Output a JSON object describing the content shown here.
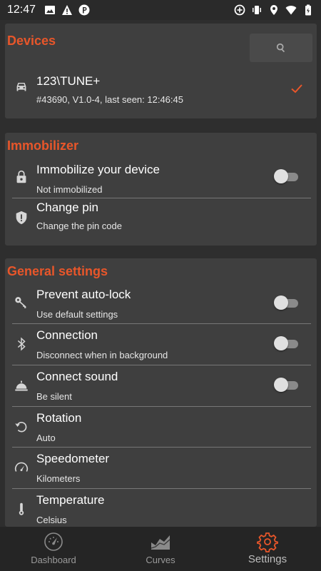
{
  "status_bar": {
    "time": "12:47",
    "left_icons": [
      "image-icon",
      "warning-icon",
      "parking-icon"
    ],
    "right_icons": [
      "data-saver-icon",
      "vibrate-icon",
      "location-icon",
      "wifi-icon",
      "battery-icon"
    ]
  },
  "devices": {
    "title": "Devices",
    "search_icon": "search-icon",
    "device": {
      "name": "123\\TUNE+",
      "detail": "#43690, V1.0-4, last seen: 12:46:45",
      "selected": true
    }
  },
  "immobilizer": {
    "title": "Immobilizer",
    "items": [
      {
        "title": "Immobilize your device",
        "sub": "Not immobilized",
        "toggle": false,
        "icon": "lock-icon"
      },
      {
        "title": "Change pin",
        "sub": "Change the pin code",
        "icon": "shield-icon"
      }
    ]
  },
  "general": {
    "title": "General settings",
    "items": [
      {
        "title": "Prevent auto-lock",
        "sub": "Use default settings",
        "toggle": false,
        "icon": "key-icon"
      },
      {
        "title": "Connection",
        "sub": "Disconnect when in background",
        "toggle": false,
        "icon": "bluetooth-icon"
      },
      {
        "title": "Connect sound",
        "sub": "Be silent",
        "toggle": false,
        "icon": "bell-icon"
      },
      {
        "title": "Rotation",
        "sub": "Auto",
        "icon": "rotation-icon"
      },
      {
        "title": "Speedometer",
        "sub": "Kilometers",
        "icon": "speedometer-icon"
      },
      {
        "title": "Temperature",
        "sub": "Celsius",
        "icon": "thermometer-icon"
      }
    ]
  },
  "bottom_nav": {
    "items": [
      {
        "label": "Dashboard",
        "icon": "dashboard-icon",
        "active": false
      },
      {
        "label": "Curves",
        "icon": "curves-icon",
        "active": false
      },
      {
        "label": "Settings",
        "icon": "settings-icon",
        "active": true
      }
    ]
  },
  "colors": {
    "accent": "#e8562a",
    "card": "#3f3f3f",
    "background": "#2e2e2e",
    "nav": "#252525"
  }
}
